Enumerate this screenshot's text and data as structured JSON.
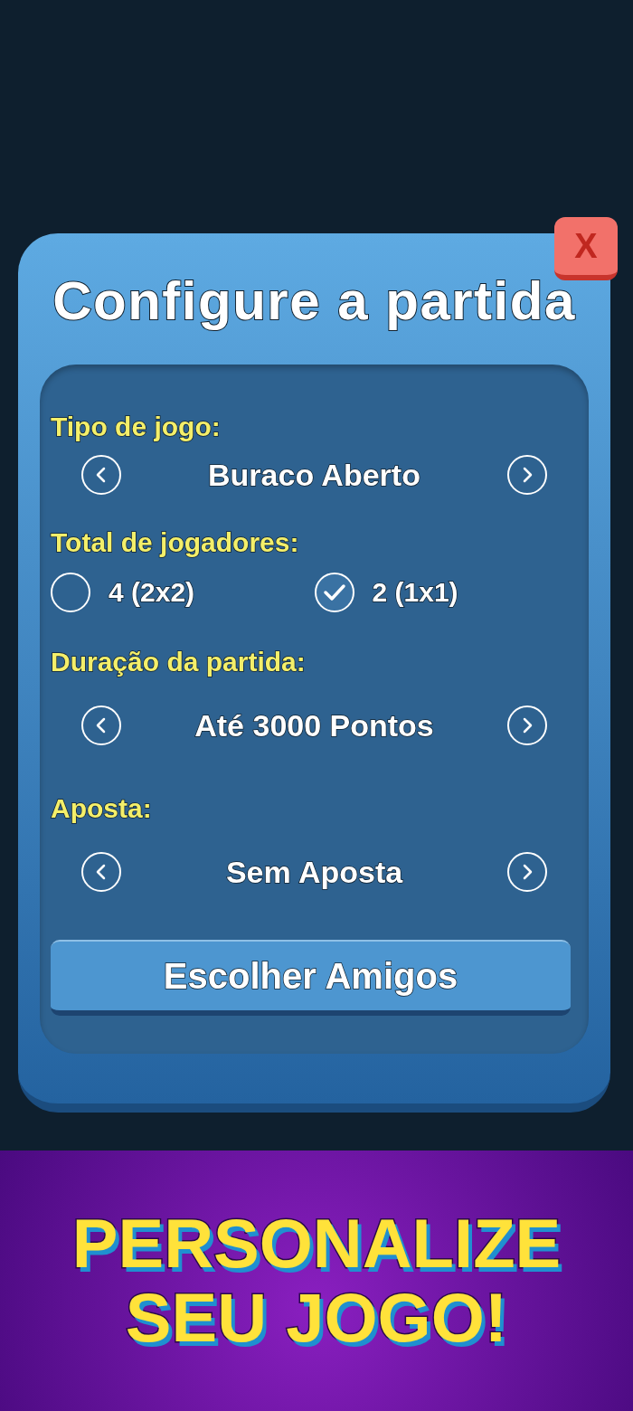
{
  "dialog": {
    "title": "Configure a partida",
    "close_label": "X"
  },
  "settings": [
    {
      "kind": "selector",
      "label": "Tipo de jogo:",
      "value": "Buraco Aberto"
    },
    {
      "kind": "radio",
      "label": "Total de jogadores:",
      "options": [
        {
          "label": "4 (2x2)",
          "selected": false
        },
        {
          "label": "2 (1x1)",
          "selected": true
        }
      ]
    },
    {
      "kind": "selector",
      "label": "Duração da partida:",
      "value": "Até 3000 Pontos"
    },
    {
      "kind": "selector",
      "label": "Aposta:",
      "value": "Sem Aposta"
    }
  ],
  "primary_button": "Escolher Amigos",
  "banner": {
    "lines": [
      "PERSONALIZE",
      "SEU JOGO!"
    ]
  }
}
